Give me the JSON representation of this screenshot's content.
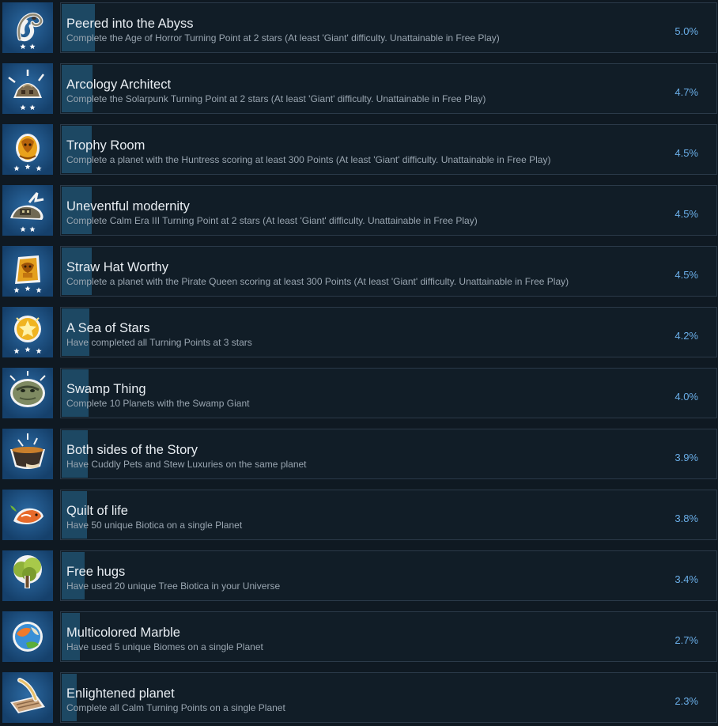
{
  "achievements": [
    {
      "title": "Peered into the Abyss",
      "description": "Complete the Age of Horror Turning Point at 2 stars (At least 'Giant' difficulty. Unattainable in Free Play)",
      "percent": "5.0%",
      "percent_value": 5.0,
      "icon": "abyss-creature-icon",
      "stars": 2
    },
    {
      "title": "Arcology Architect",
      "description": "Complete the Solarpunk Turning Point at 2 stars (At least 'Giant' difficulty. Unattainable in Free Play)",
      "percent": "4.7%",
      "percent_value": 4.7,
      "icon": "arcology-dome-icon",
      "stars": 2
    },
    {
      "title": "Trophy Room",
      "description": "Complete a planet with the Huntress scoring at least 300 Points (At least 'Giant' difficulty. Unattainable in Free Play)",
      "percent": "4.5%",
      "percent_value": 4.5,
      "icon": "huntress-trophy-icon",
      "stars": 3
    },
    {
      "title": "Uneventful modernity",
      "description": "Complete Calm Era III Turning Point at 2 stars (At least 'Giant' difficulty. Unattainable in Free Play)",
      "percent": "4.5%",
      "percent_value": 4.5,
      "icon": "calm-era-icon",
      "stars": 2
    },
    {
      "title": "Straw Hat Worthy",
      "description": "Complete a planet with the Pirate Queen scoring at least 300 Points (At least 'Giant' difficulty. Unattainable in Free Play)",
      "percent": "4.5%",
      "percent_value": 4.5,
      "icon": "pirate-queen-icon",
      "stars": 3
    },
    {
      "title": "A Sea of Stars",
      "description": "Have completed all Turning Points at 3 stars",
      "percent": "4.2%",
      "percent_value": 4.2,
      "icon": "golden-stars-icon",
      "stars": 3
    },
    {
      "title": "Swamp Thing",
      "description": "Complete 10 Planets with the Swamp Giant",
      "percent": "4.0%",
      "percent_value": 4.0,
      "icon": "swamp-giant-icon",
      "stars": 0
    },
    {
      "title": "Both sides of the Story",
      "description": "Have Cuddly Pets and Stew Luxuries on the same planet",
      "percent": "3.9%",
      "percent_value": 3.9,
      "icon": "stew-pot-icon",
      "stars": 0
    },
    {
      "title": "Quilt of life",
      "description": "Have 50 unique Biotica on a single Planet",
      "percent": "3.8%",
      "percent_value": 3.8,
      "icon": "biotica-fish-icon",
      "stars": 0
    },
    {
      "title": "Free hugs",
      "description": "Have used 20 unique Tree Biotica in your Universe",
      "percent": "3.4%",
      "percent_value": 3.4,
      "icon": "tree-icon",
      "stars": 0
    },
    {
      "title": "Multicolored Marble",
      "description": "Have used 5 unique Biomes on a single Planet",
      "percent": "2.7%",
      "percent_value": 2.7,
      "icon": "planet-globe-icon",
      "stars": 0
    },
    {
      "title": "Enlightened planet",
      "description": "Complete all Calm Turning Points on a single Planet",
      "percent": "2.3%",
      "percent_value": 2.3,
      "icon": "scroll-quill-icon",
      "stars": 0
    }
  ],
  "colors": {
    "background": "#0f1922",
    "panel": "#111d27",
    "panel_border": "#2b3a49",
    "progress_fill": "#1d4863",
    "icon_bg": "#1b4a7a",
    "percent_text": "#6aaee8"
  }
}
